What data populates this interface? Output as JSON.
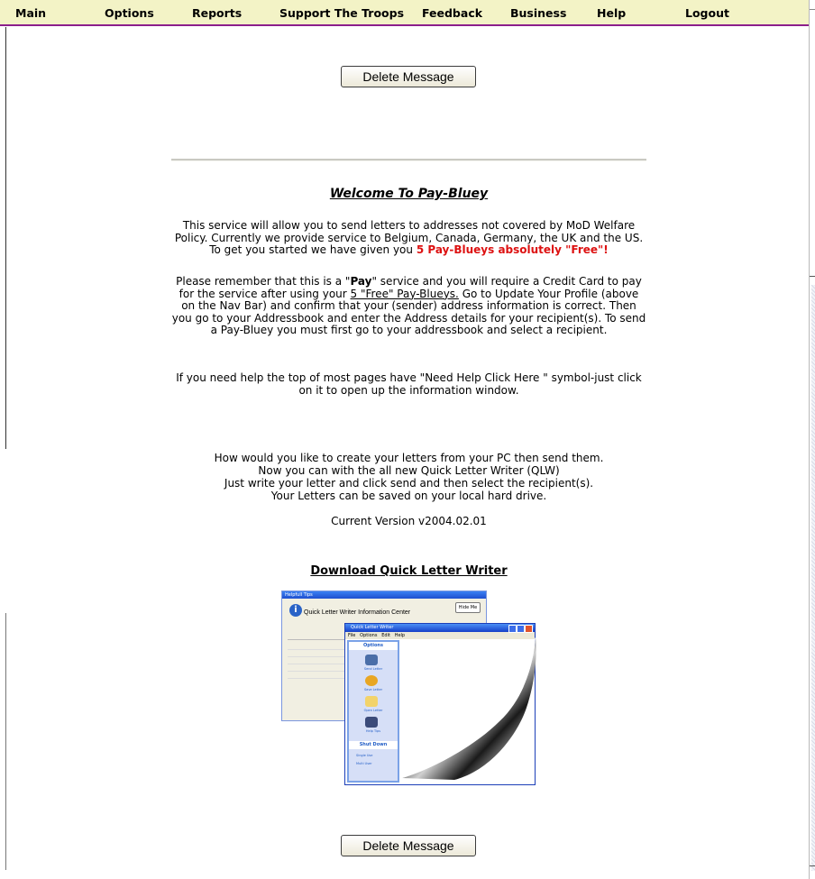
{
  "nav": {
    "items": [
      "Main",
      "Options",
      "Reports",
      "Support The Troops",
      "Feedback",
      "Business",
      "Help",
      "Logout"
    ]
  },
  "buttons": {
    "delete_top": "Delete Message",
    "delete_bottom": "Delete Message"
  },
  "welcome": {
    "title": "Welcome To Pay-Bluey",
    "para1_start": "This service will allow you to send letters to addresses not covered by MoD Welfare Policy. Currently we provide service to Belgium, Canada, Germany, the UK and the US. To get you started we have given you ",
    "para1_highlight": "5 Pay-Blueys absolutely \"Free\"!",
    "para2_start": "Please remember that this is a \"",
    "para2_bold": "Pay",
    "para2_mid": "\" service and you will require a Credit Card to pay for the service after using your ",
    "para2_link": "5 \"Free\" Pay-Blueys.",
    "para2_end": " Go to Update Your Profile (above on the Nav Bar) and confirm that your (sender) address information is correct. Then you go to your Addressbook and enter the Address details for your recipient(s). To send a Pay-Bluey you must first go to your addressbook and select a recipient.",
    "para3": "If you need help the top of most pages have \"Need Help Click Here \" symbol-just click on it to open up the information window."
  },
  "qlw": {
    "line1": "How would you like to create your letters from your PC then send them.",
    "line2": "Now you can with the all new Quick Letter Writer (QLW)",
    "line3": "Just write your letter and click send and then select the recipient(s).",
    "line4": "Your Letters can be saved on your local hard drive.",
    "version": "Current Version v2004.02.01",
    "download_label": "Download Quick Letter Writer"
  },
  "preview": {
    "info_window_title": "Helpfull Tips",
    "info_header": "Quick Letter Writer Information Center",
    "hide_button": "Hide Me",
    "app_window_title": "Quick Letter Writer",
    "menu": [
      "File",
      "Options",
      "Edit",
      "Help"
    ],
    "panel_title": "Options",
    "panel_items": [
      "Send Letter",
      "Save Letter",
      "Open Letter",
      "Help Tips"
    ],
    "shut_panel_title": "Shut Down",
    "shut_items": [
      "Single Use",
      "Multi User"
    ]
  },
  "colors": {
    "nav_bg": "#f3f3c6",
    "nav_border": "#8b1f8b",
    "highlight_red": "#dd1111"
  }
}
